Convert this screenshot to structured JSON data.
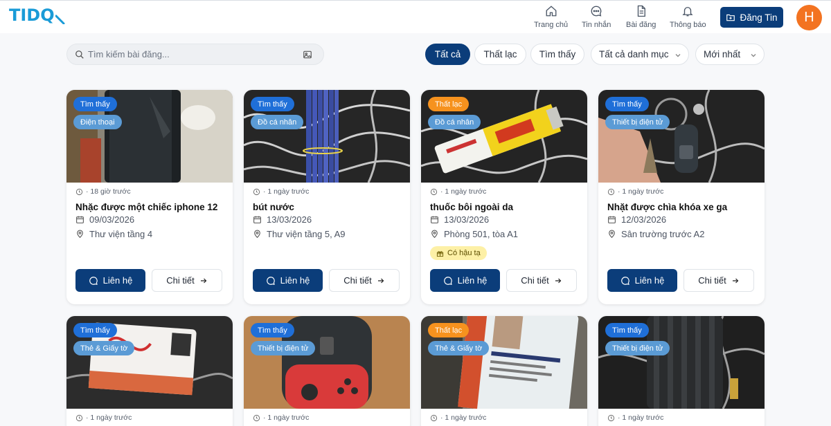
{
  "header": {
    "logo": "TIDQ",
    "nav": [
      {
        "label": "Trang chủ",
        "icon": "home-icon"
      },
      {
        "label": "Tin nhắn",
        "icon": "chat-icon"
      },
      {
        "label": "Bài đăng",
        "icon": "document-icon"
      },
      {
        "label": "Thông báo",
        "icon": "bell-icon"
      }
    ],
    "post_button": "Đăng Tin",
    "avatar_initial": "H"
  },
  "toolbar": {
    "search_placeholder": "Tìm kiếm bài đăng...",
    "filters": [
      "Tất cả",
      "Thất lạc",
      "Tìm thấy"
    ],
    "category_select": "Tất cả danh mục",
    "sort_select": "Mới nhất"
  },
  "colors": {
    "primary": "#0b3d7a",
    "found_badge": "#1f6fd8",
    "lost_badge": "#f6921e",
    "category_badge": "#5b9bd5",
    "reward_badge": "#fdf0a6",
    "avatar": "#f37321",
    "logo": "#1a9bd7"
  },
  "posts": [
    {
      "status": "Tìm thấy",
      "category": "Điện thoại",
      "time": "· 18 giờ trước",
      "title": "Nhặc được một chiếc iphone 12",
      "date": "09/03/2026",
      "location": "Thư viện tầng 4",
      "contact": "Liên hệ",
      "detail": "Chi tiết"
    },
    {
      "status": "Tìm thấy",
      "category": "Đồ cá nhân",
      "time": "· 1 ngày trước",
      "title": "bút nước",
      "date": "13/03/2026",
      "location": "Thư viện tầng 5, A9",
      "contact": "Liên hệ",
      "detail": "Chi tiết"
    },
    {
      "status": "Thất lạc",
      "category": "Đồ cá nhân",
      "time": "· 1 ngày trước",
      "title": "thuốc bôi ngoài da",
      "date": "13/03/2026",
      "location": "Phòng 501, tòa A1",
      "reward": "Có hậu tạ",
      "contact": "Liên hệ",
      "detail": "Chi tiết"
    },
    {
      "status": "Tìm thấy",
      "category": "Thiết bị điện tử",
      "time": "· 1 ngày trước",
      "title": "Nhặt được chìa khóa xe ga",
      "date": "12/03/2026",
      "location": "Sân trường trước A2",
      "contact": "Liên hệ",
      "detail": "Chi tiết"
    },
    {
      "status": "Tìm thấy",
      "category": "Thẻ & Giấy tờ",
      "time": "· 1 ngày trước"
    },
    {
      "status": "Tìm thấy",
      "category": "Thiết bị điện tử",
      "time": "· 1 ngày trước"
    },
    {
      "status": "Thất lạc",
      "category": "Thẻ & Giấy tờ",
      "time": "· 1 ngày trước"
    },
    {
      "status": "Tìm thấy",
      "category": "Thiết bị điện tử",
      "time": "· 1 ngày trước"
    }
  ]
}
